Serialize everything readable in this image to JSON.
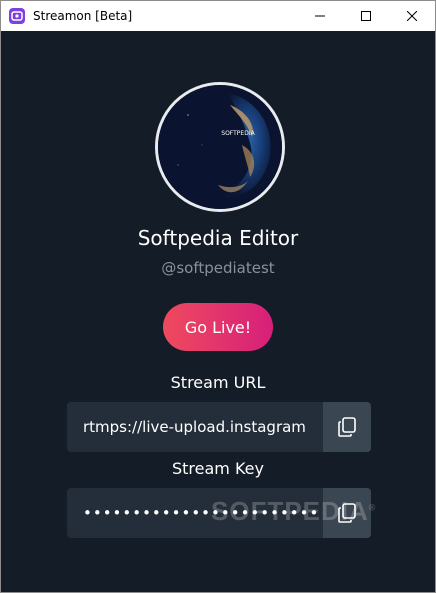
{
  "window": {
    "title": "Streamon [Beta]",
    "controls": {
      "minimize": "minimize",
      "maximize": "maximize",
      "close": "close"
    }
  },
  "profile": {
    "avatar_caption": "SOFTPEDIA",
    "name": "Softpedia Editor",
    "handle": "@softpediatest"
  },
  "actions": {
    "go_live_label": "Go Live!"
  },
  "stream_url": {
    "label": "Stream URL",
    "value": "rtmps://live-upload.instagram"
  },
  "stream_key": {
    "label": "Stream Key",
    "value": "••••••••••••••••••••••••••••"
  },
  "watermark": {
    "text": "SOFTPEDIA",
    "mark": "®"
  },
  "colors": {
    "background": "#141c27",
    "field": "#242e3a",
    "copy_button": "#3b4653",
    "go_live_start": "#ef4a5e",
    "go_live_end": "#d61f7a",
    "app_icon": "#7b3fe4"
  }
}
